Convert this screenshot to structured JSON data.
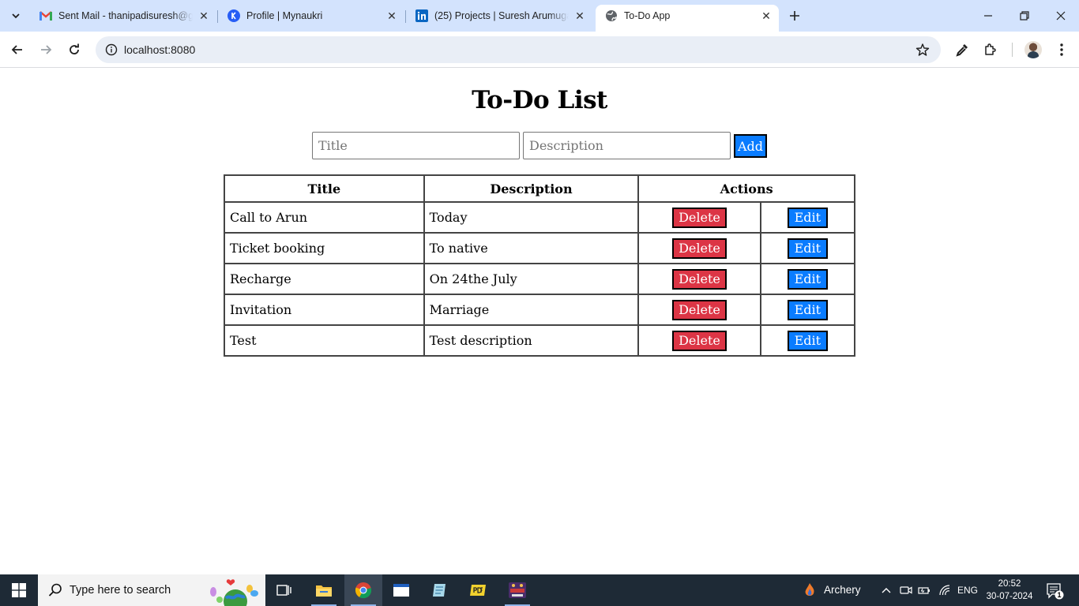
{
  "browser": {
    "tabs": [
      {
        "title": "Sent Mail - thanipadisuresh@gmail.com",
        "favicon": "gmail-icon",
        "active": false
      },
      {
        "title": "Profile | Mynaukri",
        "favicon": "naukri-icon",
        "active": false
      },
      {
        "title": "(25) Projects | Suresh Arumugam",
        "favicon": "linkedin-icon",
        "active": false
      },
      {
        "title": "To-Do App",
        "favicon": "globe-icon",
        "active": true
      }
    ],
    "url": "localhost:8080"
  },
  "app": {
    "heading": "To-Do List",
    "form": {
      "title_placeholder": "Title",
      "description_placeholder": "Description",
      "add_label": "Add"
    },
    "table": {
      "headers": [
        "Title",
        "Description",
        "Actions"
      ],
      "delete_label": "Delete",
      "edit_label": "Edit",
      "rows": [
        {
          "title": "Call to Arun",
          "description": "Today"
        },
        {
          "title": "Ticket booking",
          "description": "To native"
        },
        {
          "title": "Recharge",
          "description": "On 24the July"
        },
        {
          "title": "Invitation",
          "description": "Marriage"
        },
        {
          "title": "Test",
          "description": "Test description"
        }
      ]
    }
  },
  "taskbar": {
    "search_placeholder": "Type here to search",
    "weather_label": "Archery",
    "language": "ENG",
    "time": "20:52",
    "date": "30-07-2024",
    "notification_count": "1"
  },
  "colors": {
    "delete": "#dc3545",
    "primary": "#0a7cff",
    "tabstrip": "#d3e3fd",
    "taskbar": "#1e2a36"
  }
}
